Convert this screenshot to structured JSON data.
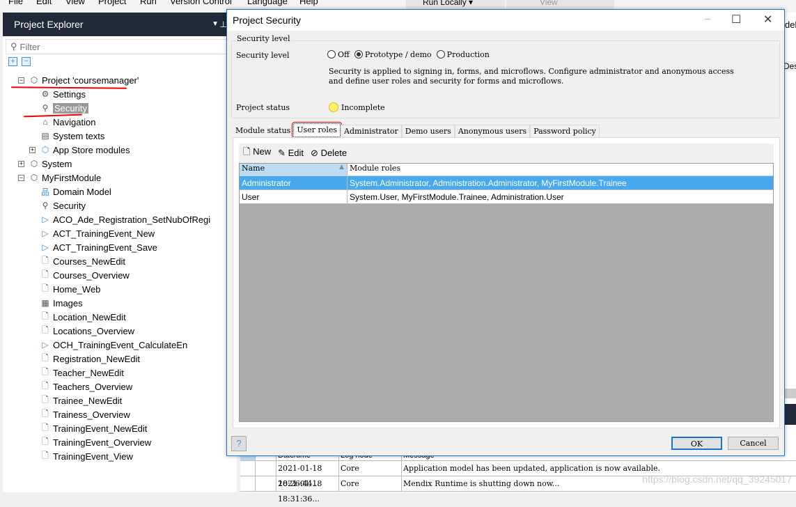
{
  "menu": [
    "File",
    "Edit",
    "View",
    "Project",
    "Run",
    "Version Control",
    "Language",
    "Help"
  ],
  "toolbar": {
    "run": "Run Locally",
    "view": "View"
  },
  "explorer": {
    "title": "Project Explorer",
    "filter_placeholder": "Filter",
    "items": [
      {
        "label": "Project 'coursemanager'",
        "level": 0,
        "exp": "−",
        "icon": "project-icon",
        "glyph": "⬡"
      },
      {
        "label": "Settings",
        "level": 1,
        "icon": "gear-icon",
        "glyph": "⚙"
      },
      {
        "label": "Security",
        "level": 1,
        "icon": "key-icon",
        "glyph": "⚲",
        "selected": true
      },
      {
        "label": "Navigation",
        "level": 1,
        "icon": "home-icon",
        "glyph": "⌂"
      },
      {
        "label": "System texts",
        "level": 1,
        "icon": "system-texts-icon",
        "glyph": "▤"
      },
      {
        "label": "App Store modules",
        "level": 1,
        "exp": "+",
        "icon": "app-store-icon",
        "glyph": "⬡"
      },
      {
        "label": "System",
        "level": 0,
        "exp": "+",
        "icon": "module-icon",
        "glyph": "⬡"
      },
      {
        "label": "MyFirstModule",
        "level": 0,
        "exp": "−",
        "icon": "module-icon",
        "glyph": "⬡"
      },
      {
        "label": "Domain Model",
        "level": 1,
        "icon": "domain-model-icon",
        "glyph": "品"
      },
      {
        "label": "Security",
        "level": 1,
        "icon": "key-icon",
        "glyph": "⚲"
      },
      {
        "label": "ACO_Ade_Registration_SetNubOfRegi",
        "level": 1,
        "icon": "microflow-icon",
        "glyph": "▷"
      },
      {
        "label": "ACT_TrainingEvent_New",
        "level": 1,
        "icon": "microflow-icon",
        "glyph": "▷"
      },
      {
        "label": "ACT_TrainingEvent_Save",
        "level": 1,
        "icon": "microflow-icon",
        "glyph": "▷"
      },
      {
        "label": "Courses_NewEdit",
        "level": 1,
        "icon": "page-icon",
        "glyph": "🗋"
      },
      {
        "label": "Courses_Overview",
        "level": 1,
        "icon": "page-icon",
        "glyph": "🗋"
      },
      {
        "label": "Home_Web",
        "level": 1,
        "icon": "page-icon",
        "glyph": "🗋"
      },
      {
        "label": "Images",
        "level": 1,
        "icon": "images-icon",
        "glyph": "▦"
      },
      {
        "label": "Location_NewEdit",
        "level": 1,
        "icon": "page-icon",
        "glyph": "🗋"
      },
      {
        "label": "Locations_Overview",
        "level": 1,
        "icon": "page-icon",
        "glyph": "🗋"
      },
      {
        "label": "OCH_TrainingEvent_CalculateEn",
        "level": 1,
        "icon": "microflow-icon",
        "glyph": "▷"
      },
      {
        "label": "Registration_NewEdit",
        "level": 1,
        "icon": "page-icon",
        "glyph": "🗋"
      },
      {
        "label": "Teacher_NewEdit",
        "level": 1,
        "icon": "page-icon",
        "glyph": "🗋"
      },
      {
        "label": "Teachers_Overview",
        "level": 1,
        "icon": "page-icon",
        "glyph": "🗋"
      },
      {
        "label": "Trainee_NewEdit",
        "level": 1,
        "icon": "page-icon",
        "glyph": "🗋"
      },
      {
        "label": "Trainess_Overview",
        "level": 1,
        "icon": "page-icon",
        "glyph": "🗋"
      },
      {
        "label": "TrainingEvent_NewEdit",
        "level": 1,
        "icon": "page-icon",
        "glyph": "🗋"
      },
      {
        "label": "TrainingEvent_Overview",
        "level": 1,
        "icon": "page-icon",
        "glyph": "🗋"
      },
      {
        "label": "TrainingEvent_View",
        "level": 1,
        "icon": "page-icon",
        "glyph": "🗋"
      }
    ]
  },
  "dialog": {
    "title": "Project Security",
    "group_label": "Security level",
    "level_label": "Security level",
    "options": [
      "Off",
      "Prototype / demo",
      "Production"
    ],
    "selected_option": "Prototype / demo",
    "description_1": "Security is applied to signing in, forms, and microflows. Configure administrator and anonymous access",
    "description_2": "and define user roles and security for forms and microflows.",
    "status_label": "Project status",
    "status_value": "Incomplete",
    "status_color": "#fff176",
    "tabs": [
      "Module status",
      "User roles",
      "Administrator",
      "Demo users",
      "Anonymous users",
      "Password policy"
    ],
    "active_tab": "User roles",
    "actions": {
      "new": "New",
      "edit": "Edit",
      "delete": "Delete"
    },
    "columns": [
      "Name",
      "Module roles"
    ],
    "rows": [
      [
        "Administrator",
        "System.Administrator, Administration.Administrator, MyFirstModule.Trainee"
      ],
      [
        "User",
        "System.User, MyFirstModule.Trainee, Administration.User"
      ]
    ],
    "ok": "OK",
    "cancel": "Cancel"
  },
  "log": {
    "columns": [
      "Date/time",
      "Log node",
      "Message"
    ],
    "rows": [
      [
        "2021-01-18 18:26:44...",
        "Core",
        "Application model has been updated, application is now available."
      ],
      [
        "2021-01-18 18:31:36...",
        "Core",
        "Mendix Runtime is shutting down now..."
      ]
    ]
  },
  "right": {
    "t1": "del",
    "t2": "Des"
  },
  "watermark": "https://blog.csdn.net/qq_39245017"
}
